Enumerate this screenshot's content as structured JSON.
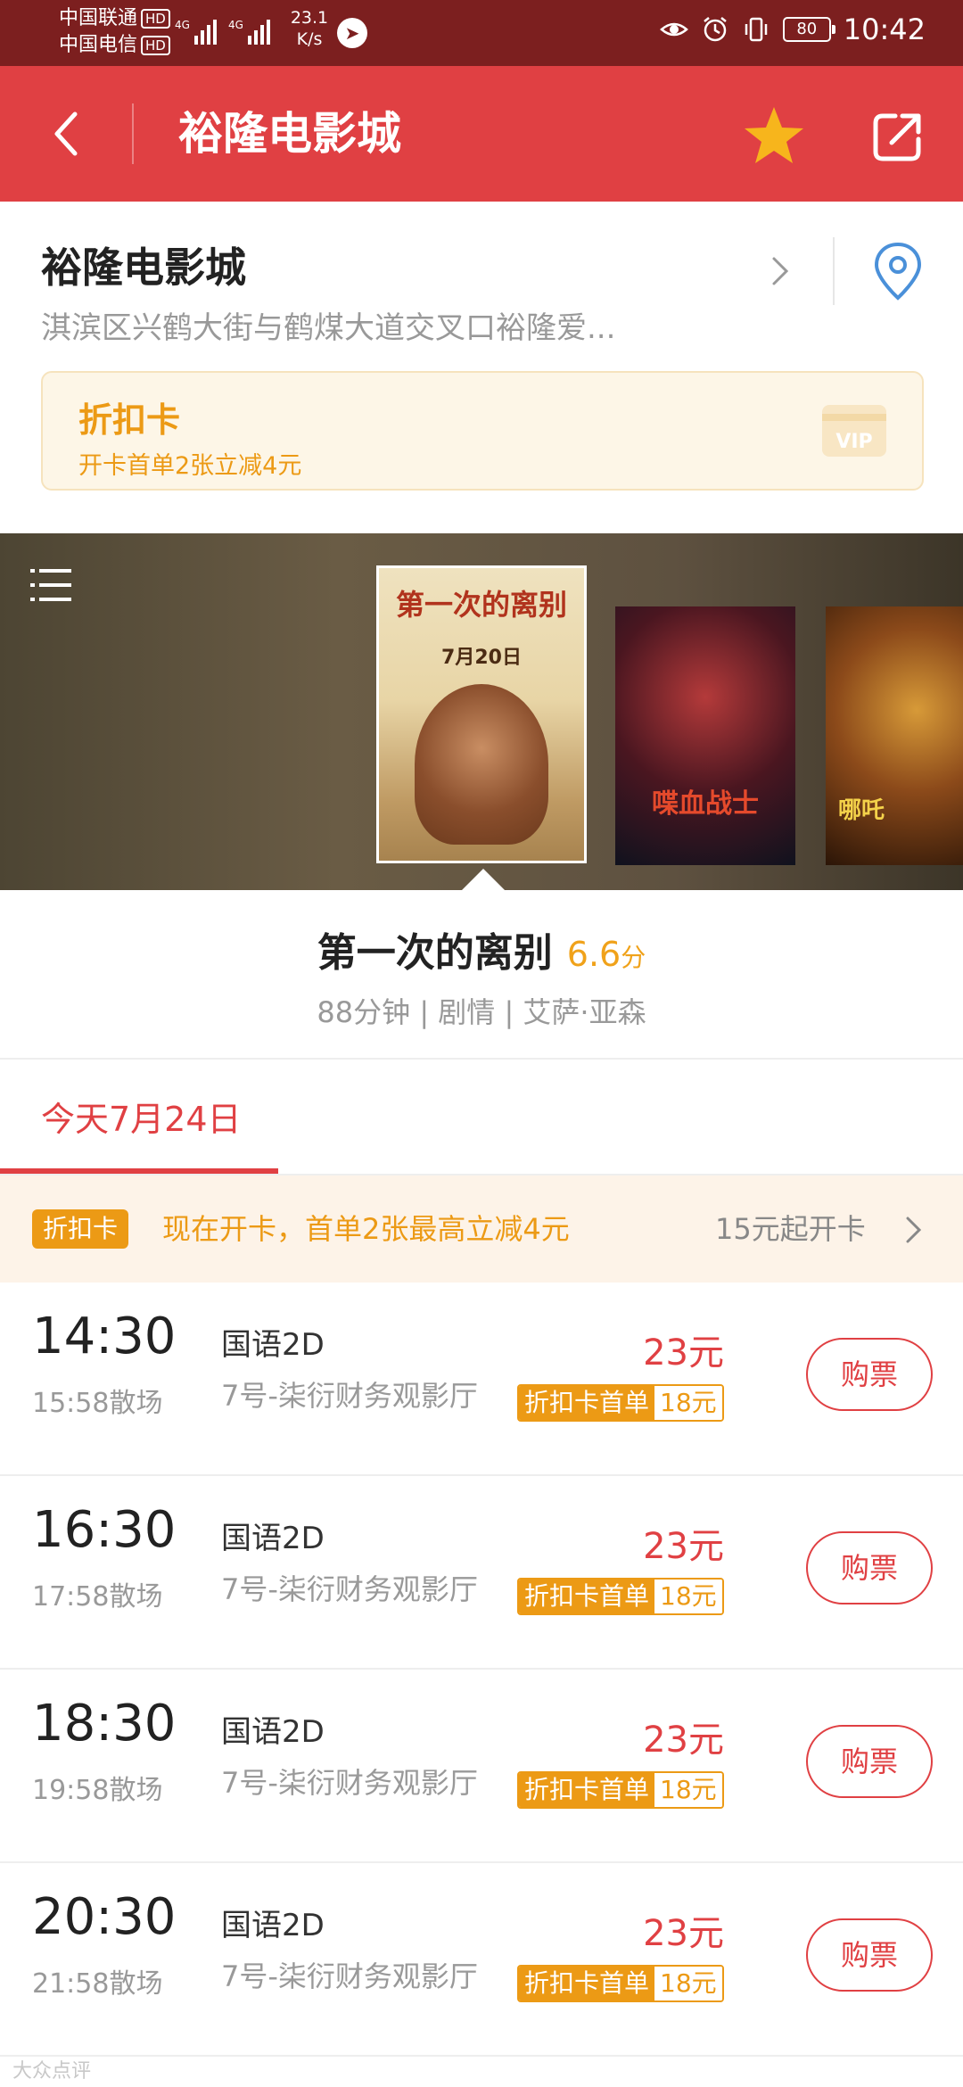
{
  "status_bar": {
    "carrier_1": "中国联通",
    "carrier_2": "中国电信",
    "hd_badge": "HD",
    "net_type": "4G",
    "speed_value": "23.1",
    "speed_unit": "K/s",
    "battery": "80",
    "time": "10:42"
  },
  "title_bar": {
    "title": "裕隆电影城"
  },
  "cinema": {
    "name": "裕隆电影城",
    "address": "淇滨区兴鹤大街与鹤煤大道交叉口裕隆爱...",
    "discount_card": {
      "title": "折扣卡",
      "subtitle": "开卡首单2张立减4元",
      "badge_text": "VIP"
    }
  },
  "posters": [
    {
      "title": "第一次的离别",
      "subtitle": "7月20日"
    },
    {
      "title": "喋血战士"
    },
    {
      "title": "哪吒"
    }
  ],
  "movie": {
    "title": "第一次的离别",
    "score": "6.6",
    "score_unit": "分",
    "meta": "88分钟 | 剧情 | 艾萨·亚森"
  },
  "date_tab": {
    "label": "今天7月24日"
  },
  "card_banner": {
    "badge": "折扣卡",
    "text": "现在开卡，首单2张最高立减4元",
    "price": "15元起开卡"
  },
  "sessions": [
    {
      "time": "14:30",
      "end": "15:58散场",
      "lang": "国语2D",
      "hall": "7号-柒衍财务观影厅",
      "price": "23元",
      "card_label": "折扣卡首单",
      "card_price": "18元",
      "buy": "购票"
    },
    {
      "time": "16:30",
      "end": "17:58散场",
      "lang": "国语2D",
      "hall": "7号-柒衍财务观影厅",
      "price": "23元",
      "card_label": "折扣卡首单",
      "card_price": "18元",
      "buy": "购票"
    },
    {
      "time": "18:30",
      "end": "19:58散场",
      "lang": "国语2D",
      "hall": "7号-柒衍财务观影厅",
      "price": "23元",
      "card_label": "折扣卡首单",
      "card_price": "18元",
      "buy": "购票"
    },
    {
      "time": "20:30",
      "end": "21:58散场",
      "lang": "国语2D",
      "hall": "7号-柒衍财务观影厅",
      "price": "23元",
      "card_label": "折扣卡首单",
      "card_price": "18元",
      "buy": "购票"
    }
  ],
  "watermark": "大众点评",
  "colors": {
    "brand_red": "#e04043",
    "status_bar": "#7c1f1f",
    "accent_orange": "#ec9a15",
    "score_gold": "#f0a21a"
  }
}
